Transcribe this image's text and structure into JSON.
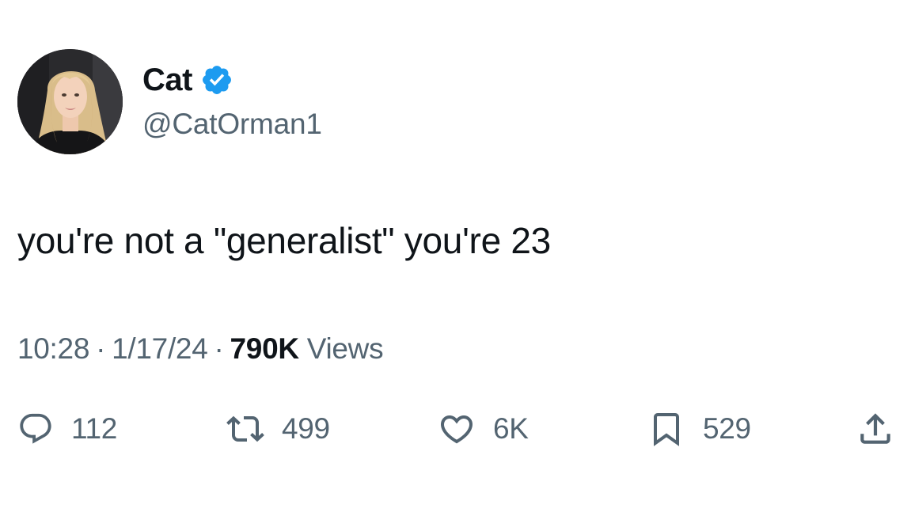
{
  "author": {
    "display_name": "Cat",
    "handle": "@CatOrman1",
    "verified": true,
    "verified_color": "#1d9bf0"
  },
  "tweet": {
    "text": "you're not a \"generalist\" you're 23",
    "time": "10:28",
    "date": "1/17/24",
    "separator": "·",
    "views_count": "790K",
    "views_label": "Views"
  },
  "actions": {
    "replies": "112",
    "reposts": "499",
    "likes": "6K",
    "bookmarks": "529"
  },
  "icons": {
    "reply": "speech-bubble-icon",
    "repost": "repost-arrows-icon",
    "like": "heart-icon",
    "bookmark": "bookmark-icon",
    "share": "share-upload-icon",
    "verified": "verified-badge-icon"
  },
  "colors": {
    "text_primary": "#0f1419",
    "text_secondary": "#536471",
    "icon": "#536471"
  }
}
